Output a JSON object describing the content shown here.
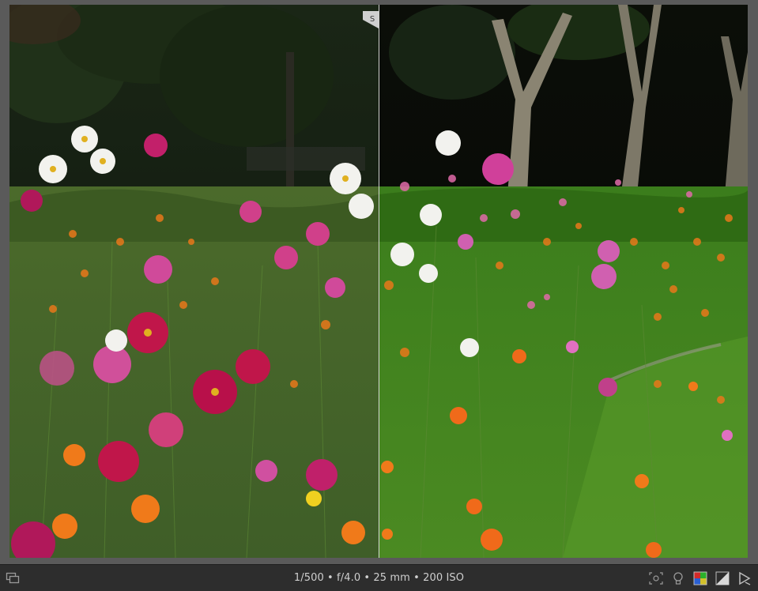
{
  "viewer": {
    "split_handle_label": "S",
    "compare_mode": "split-before-after"
  },
  "status_bar": {
    "exif": "1/500 • f/4.0 • 25 mm • 200 ISO",
    "icons": [
      "second-window-icon",
      "focus-peaking-icon",
      "lightbulb-icon",
      "color-assessment-icon",
      "softproof-icon",
      "preview-arrow-icon"
    ]
  },
  "colors": {
    "statusbar_bg": "#2d2d2d",
    "workspace_bg": "#5a5a5a",
    "text": "#cfcfcf"
  }
}
